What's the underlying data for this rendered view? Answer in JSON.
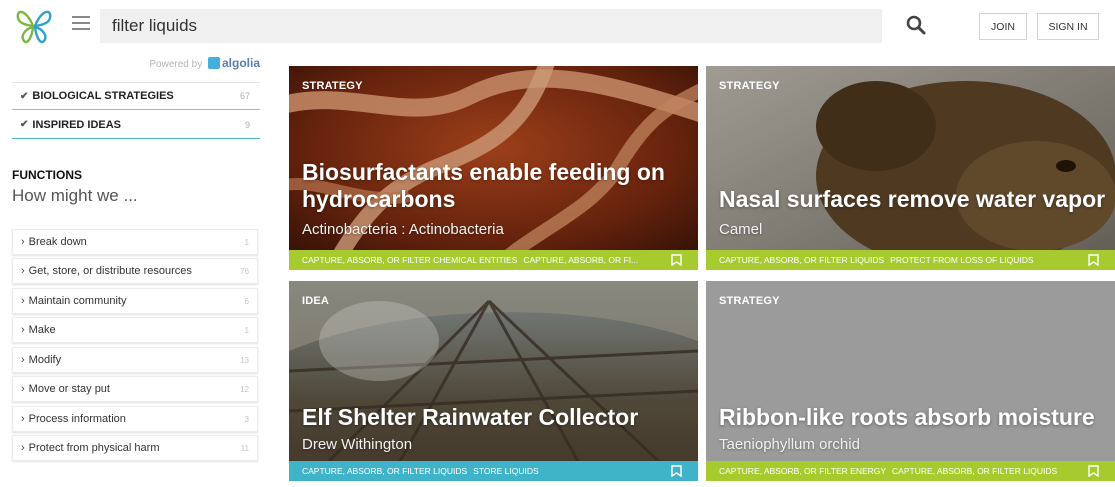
{
  "search": {
    "value": "filter liquids"
  },
  "header": {
    "join_label": "JOIN",
    "signin_label": "SIGN IN"
  },
  "powered_by": {
    "text": "Powered by",
    "brand": "algolia"
  },
  "type_filters": [
    {
      "label": "BIOLOGICAL STRATEGIES",
      "count": "67",
      "color": "#a6c95a"
    },
    {
      "label": "INSPIRED IDEAS",
      "count": "9",
      "color": "#4db3c6"
    }
  ],
  "functions": {
    "heading": "FUNCTIONS",
    "subheading": "How might we ...",
    "items": [
      {
        "label": "Break down",
        "count": "1"
      },
      {
        "label": "Get, store, or distribute resources",
        "count": "76"
      },
      {
        "label": "Maintain community",
        "count": "6"
      },
      {
        "label": "Make",
        "count": "1"
      },
      {
        "label": "Modify",
        "count": "13"
      },
      {
        "label": "Move or stay put",
        "count": "12"
      },
      {
        "label": "Process information",
        "count": "3"
      },
      {
        "label": "Protect from physical harm",
        "count": "11"
      }
    ]
  },
  "cards": [
    {
      "type": "STRATEGY",
      "title_line1": "Biosurfactants enable feeding on",
      "title_line2": "hydrocarbons",
      "subtitle": "Actinobacteria : Actinobacteria",
      "tags": [
        "CAPTURE, ABSORB, OR FILTER CHEMICAL ENTITIES",
        "CAPTURE, ABSORB, OR FI..."
      ],
      "bar_color": "#a7cb2f"
    },
    {
      "type": "STRATEGY",
      "title_line1": "Nasal surfaces remove water vapor",
      "subtitle": "Camel",
      "tags": [
        "CAPTURE, ABSORB, OR FILTER LIQUIDS",
        "PROTECT FROM LOSS OF LIQUIDS"
      ],
      "bar_color": "#a7cb2f"
    },
    {
      "type": "IDEA",
      "title_line1": "Elf Shelter Rainwater Collector",
      "subtitle": "Drew Withington",
      "tags": [
        "CAPTURE, ABSORB, OR FILTER LIQUIDS",
        "STORE LIQUIDS"
      ],
      "bar_color": "#3fb3c7"
    },
    {
      "type": "STRATEGY",
      "title_line1": "Ribbon-like roots absorb moisture",
      "subtitle": "Taeniophyllum orchid",
      "tags": [
        "CAPTURE, ABSORB, OR FILTER ENERGY",
        "CAPTURE, ABSORB, OR FILTER LIQUIDS"
      ],
      "bar_color": "#a7cb2f"
    }
  ]
}
